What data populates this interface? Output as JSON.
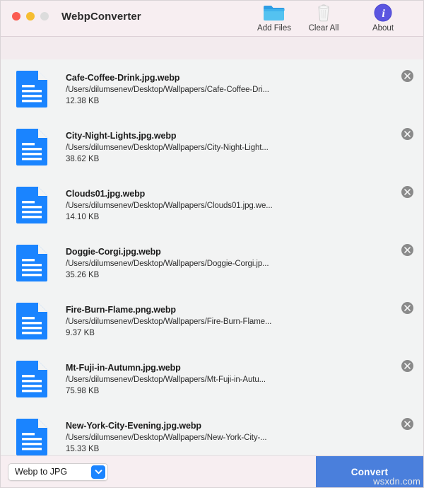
{
  "window": {
    "title": "WebpConverter",
    "traffic_lights": [
      "close-red",
      "minimize-yellow",
      "zoom-grey"
    ]
  },
  "toolbar": {
    "items": [
      {
        "label": "Add Files",
        "icon": "folder-icon"
      },
      {
        "label": "Clear All",
        "icon": "trash-icon"
      },
      {
        "label": "About",
        "icon": "info-icon"
      }
    ]
  },
  "file_list": {
    "remove_icon": "close-circle-icon",
    "file_icon": "document-icon",
    "rows": [
      {
        "name": "Cafe-Coffee-Drink.jpg.webp",
        "path": "/Users/dilumsenev/Desktop/Wallpapers/Cafe-Coffee-Dri...",
        "size": "12.38 KB"
      },
      {
        "name": "City-Night-Lights.jpg.webp",
        "path": "/Users/dilumsenev/Desktop/Wallpapers/City-Night-Light...",
        "size": "38.62 KB"
      },
      {
        "name": "Clouds01.jpg.webp",
        "path": "/Users/dilumsenev/Desktop/Wallpapers/Clouds01.jpg.we...",
        "size": "14.10 KB"
      },
      {
        "name": "Doggie-Corgi.jpg.webp",
        "path": "/Users/dilumsenev/Desktop/Wallpapers/Doggie-Corgi.jp...",
        "size": "35.26 KB"
      },
      {
        "name": "Fire-Burn-Flame.png.webp",
        "path": "/Users/dilumsenev/Desktop/Wallpapers/Fire-Burn-Flame...",
        "size": "9.37 KB"
      },
      {
        "name": "Mt-Fuji-in-Autumn.jpg.webp",
        "path": "/Users/dilumsenev/Desktop/Wallpapers/Mt-Fuji-in-Autu...",
        "size": "75.98 KB"
      },
      {
        "name": "New-York-City-Evening.jpg.webp",
        "path": "/Users/dilumsenev/Desktop/Wallpapers/New-York-City-...",
        "size": "15.33 KB"
      }
    ]
  },
  "bottom_bar": {
    "conversion_mode": "Webp to JPG",
    "dropdown_icon": "chevron-down-icon",
    "convert_label": "Convert"
  },
  "watermark": "wsxdn.com",
  "colors": {
    "titlebar_bg": "#f7eef1",
    "subbar_bg": "#f3ebee",
    "list_bg": "#f2f3f3",
    "doc_icon_blue": "#1a84ff",
    "accent_blue": "#1a84ff",
    "convert_blue": "#4a7fdc",
    "about_purple": "#5b55e0",
    "remove_grey": "#8a8a8a"
  }
}
